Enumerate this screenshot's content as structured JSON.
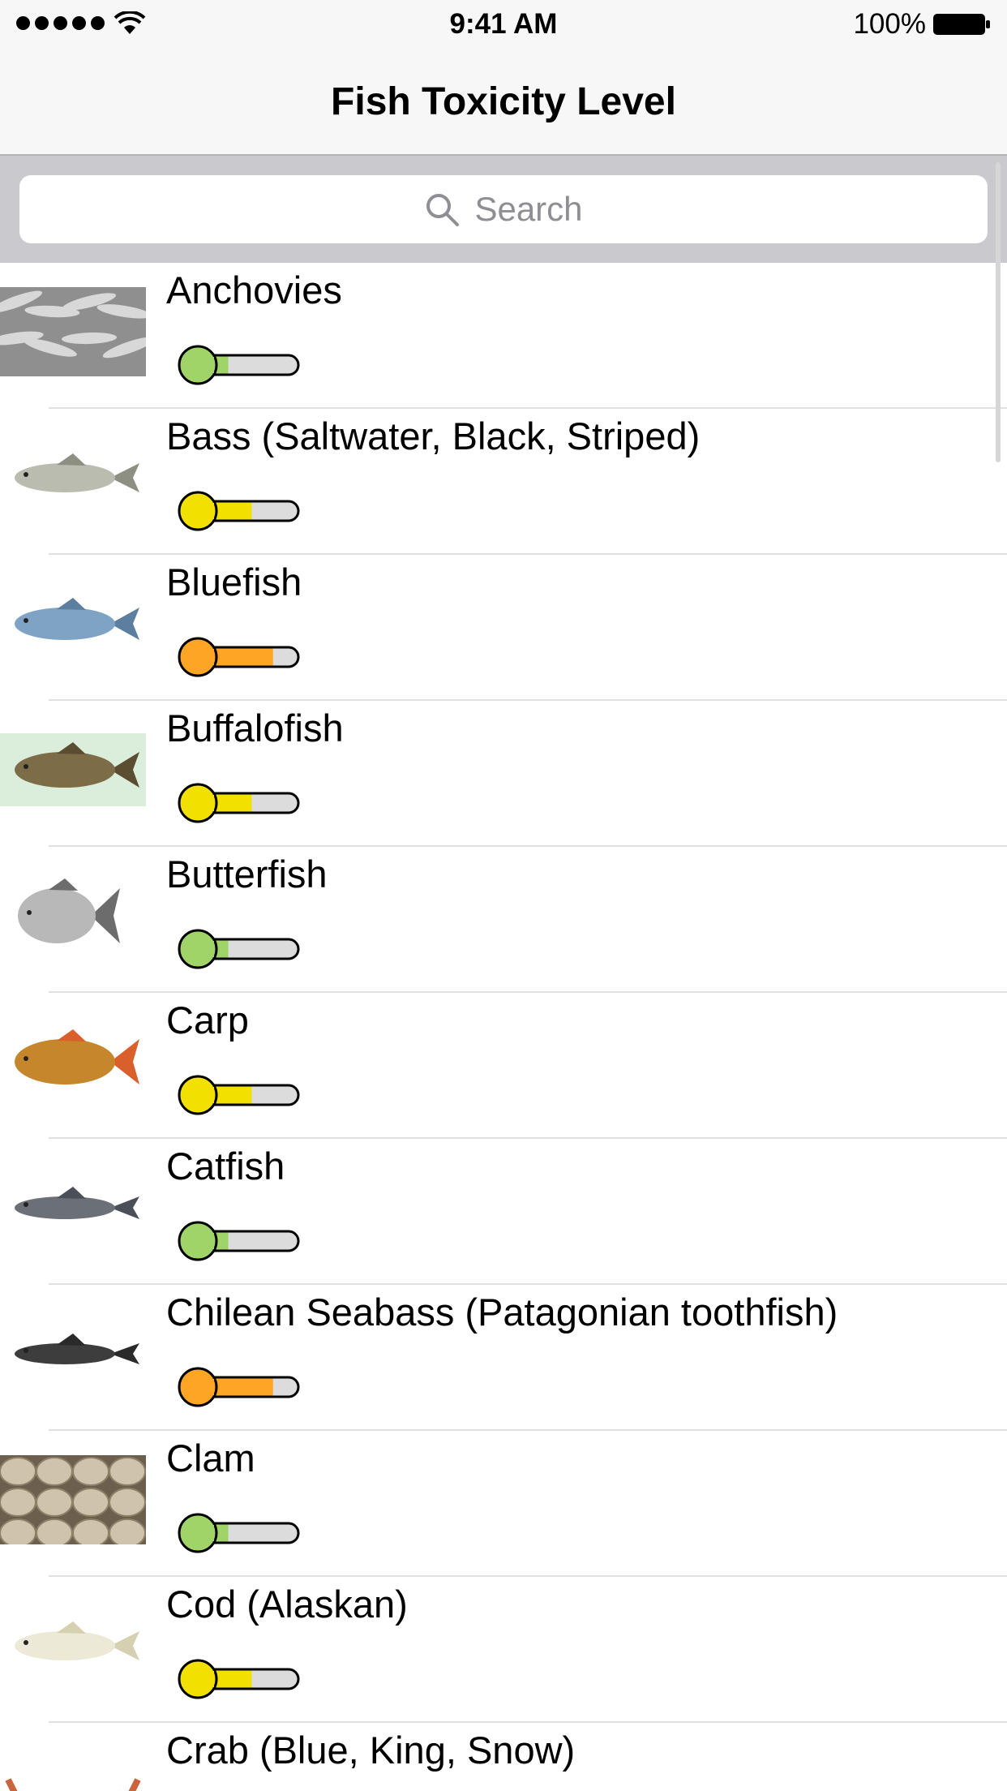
{
  "status_bar": {
    "time": "9:41 AM",
    "battery": "100%",
    "signal_icon": "cellular-signal-dots",
    "wifi_icon": "wifi-icon",
    "battery_icon": "battery-full-icon"
  },
  "nav": {
    "title": "Fish Toxicity Level"
  },
  "search": {
    "placeholder": "Search",
    "icon": "search-icon"
  },
  "level_colors": {
    "low": "#a0d468",
    "moderate": "#f2e000",
    "high": "#ffa526",
    "track": "#dcdcdc"
  },
  "fish": [
    {
      "name": "Anchovies",
      "level": "low",
      "fill": 0.28,
      "thumb": "anchovies"
    },
    {
      "name": "Bass (Saltwater, Black, Striped)",
      "level": "moderate",
      "fill": 0.52,
      "thumb": "bass"
    },
    {
      "name": "Bluefish",
      "level": "high",
      "fill": 0.74,
      "thumb": "bluefish"
    },
    {
      "name": "Buffalofish",
      "level": "moderate",
      "fill": 0.52,
      "thumb": "buffalofish"
    },
    {
      "name": "Butterfish",
      "level": "low",
      "fill": 0.28,
      "thumb": "butterfish"
    },
    {
      "name": "Carp",
      "level": "moderate",
      "fill": 0.52,
      "thumb": "carp"
    },
    {
      "name": "Catfish",
      "level": "low",
      "fill": 0.28,
      "thumb": "catfish"
    },
    {
      "name": "Chilean Seabass (Patagonian toothfish)",
      "level": "high",
      "fill": 0.74,
      "thumb": "seabass"
    },
    {
      "name": "Clam",
      "level": "low",
      "fill": 0.28,
      "thumb": "clam"
    },
    {
      "name": "Cod (Alaskan)",
      "level": "moderate",
      "fill": 0.52,
      "thumb": "cod"
    },
    {
      "name": "Crab (Blue, King, Snow)",
      "level": "",
      "fill": 0,
      "thumb": "crab"
    }
  ]
}
